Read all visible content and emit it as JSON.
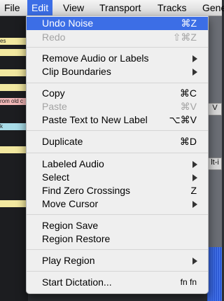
{
  "menubar": {
    "items": [
      "File",
      "Edit",
      "View",
      "Transport",
      "Tracks",
      "Gene"
    ],
    "active": "Edit"
  },
  "background": {
    "labels": [
      "es",
      "rom old c",
      "k"
    ],
    "controls": [
      "V",
      "lt-i"
    ]
  },
  "menu": {
    "undo": {
      "label": "Undo Noise",
      "shortcut": "⌘Z"
    },
    "redo": {
      "label": "Redo",
      "shortcut": "⇧⌘Z"
    },
    "remove_audio": {
      "label": "Remove Audio or Labels"
    },
    "clip_boundaries": {
      "label": "Clip Boundaries"
    },
    "copy": {
      "label": "Copy",
      "shortcut": "⌘C"
    },
    "paste": {
      "label": "Paste",
      "shortcut": "⌘V"
    },
    "paste_new_label": {
      "label": "Paste Text to New Label",
      "shortcut": "⌥⌘V"
    },
    "duplicate": {
      "label": "Duplicate",
      "shortcut": "⌘D"
    },
    "labeled_audio": {
      "label": "Labeled Audio"
    },
    "select": {
      "label": "Select"
    },
    "find_zero": {
      "label": "Find Zero Crossings",
      "shortcut": "Z"
    },
    "move_cursor": {
      "label": "Move Cursor"
    },
    "region_save": {
      "label": "Region Save"
    },
    "region_restore": {
      "label": "Region Restore"
    },
    "play_region": {
      "label": "Play Region"
    },
    "start_dictation": {
      "label": "Start Dictation...",
      "shortcut": "fn fn"
    }
  },
  "colors": {
    "highlight": "#3c6ee6",
    "disabled_text": "#a3a3a3",
    "label_yellow": "#f2e8a0",
    "label_pink": "#f3b8b8",
    "label_cyan": "#a8dce8"
  }
}
